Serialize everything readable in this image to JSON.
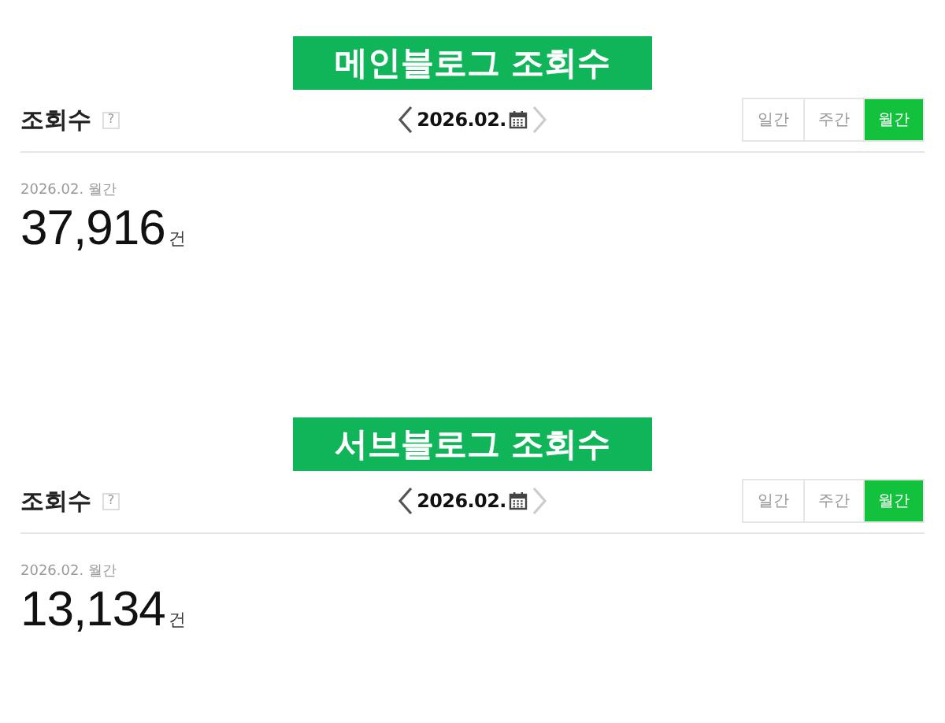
{
  "sections": [
    {
      "banner": "메인블로그 조회수",
      "title": "조회수",
      "help": "?",
      "date": "2026.02.",
      "prev_disabled": false,
      "next_disabled": true,
      "tabs": [
        {
          "label": "일간",
          "selected": false
        },
        {
          "label": "주간",
          "selected": false
        },
        {
          "label": "월간",
          "selected": true
        }
      ],
      "period": "2026.02. 월간",
      "count": "37,916",
      "unit": "건"
    },
    {
      "banner": "서브블로그 조회수",
      "title": "조회수",
      "help": "?",
      "date": "2026.02.",
      "prev_disabled": false,
      "next_disabled": true,
      "tabs": [
        {
          "label": "일간",
          "selected": false
        },
        {
          "label": "주간",
          "selected": false
        },
        {
          "label": "월간",
          "selected": true
        }
      ],
      "period": "2026.02. 월간",
      "count": "13,134",
      "unit": "건"
    }
  ]
}
